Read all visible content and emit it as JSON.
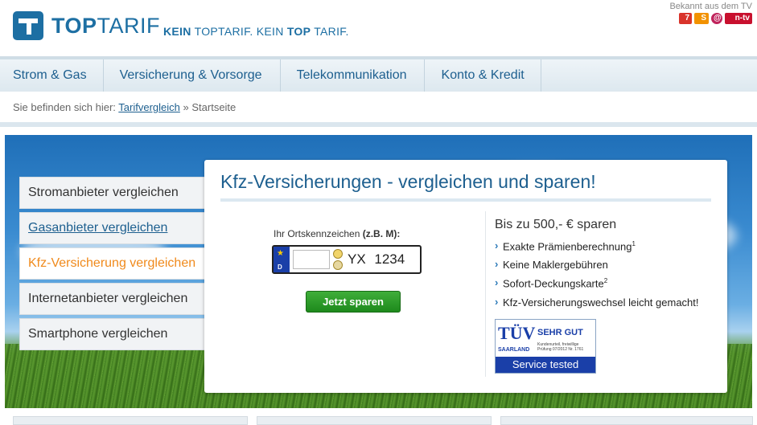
{
  "brand": {
    "logo_bold": "TOP",
    "logo_rest": "TARIF",
    "slogan_part1": "KEIN",
    "slogan_part2": " TOPTARIF. KEIN ",
    "slogan_part3": "TOP",
    "slogan_part4": " TARIF.",
    "accent_color": "#1d6fa3"
  },
  "tv": {
    "label": "Bekannt aus dem TV",
    "logo_1": "7",
    "logo_2": "S",
    "logo_3": "@",
    "logo_4": "n-tv"
  },
  "nav": {
    "items": [
      {
        "label": "Strom & Gas"
      },
      {
        "label": "Versicherung & Vorsorge"
      },
      {
        "label": "Telekommunikation"
      },
      {
        "label": "Konto & Kredit"
      }
    ]
  },
  "breadcrumb": {
    "prefix": "Sie befinden sich hier: ",
    "link": "Tarifvergleich",
    "separator": " » ",
    "current": "Startseite"
  },
  "sidebar": {
    "items": [
      {
        "label": "Stromanbieter vergleichen"
      },
      {
        "label": "Gasanbieter vergleichen"
      },
      {
        "label": "Kfz-Versicherung vergleichen"
      },
      {
        "label": "Internetanbieter vergleichen"
      },
      {
        "label": "Smartphone vergleichen"
      }
    ]
  },
  "panel": {
    "title": "Kfz-Versicherungen - vergleichen und sparen!",
    "plate_label": "Ihr Ortskennzeichen ",
    "plate_hint": "(z.B. M):",
    "plate_country": "D",
    "plate_suffix": "YX 1234",
    "plate_input_value": "",
    "submit_label": "Jetzt sparen"
  },
  "benefits": {
    "title": "Bis zu 500,- € sparen",
    "items": [
      {
        "text": "Exakte Prämienberechnung",
        "sup": "1"
      },
      {
        "text": "Keine Maklergebühren",
        "sup": ""
      },
      {
        "text": "Sofort-Deckungskarte",
        "sup": "2"
      },
      {
        "text": "Kfz-Versicherungswechsel leicht gemacht!",
        "sup": ""
      }
    ]
  },
  "tuv": {
    "logo": "TÜV",
    "region": "SAARLAND",
    "grade": "SEHR GUT",
    "note": "Kundenurteil, freiwillige Prüfung 07/2012 Nr. 1761",
    "band": "Service tested"
  }
}
